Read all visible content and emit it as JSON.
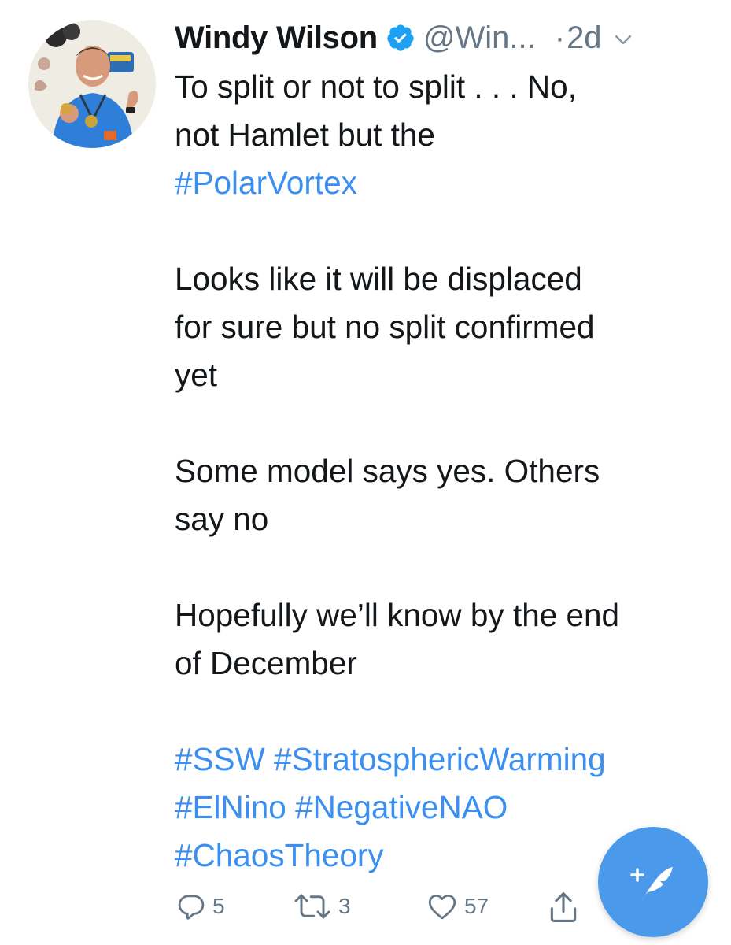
{
  "tweet": {
    "author": {
      "name": "Windy Wilson",
      "handle": "@Win...",
      "verified": true
    },
    "timestamp_separator": "·",
    "timestamp": "2d",
    "paragraphs": [
      {
        "lines": [
          [
            {
              "text": "To split or not to split . . . No,",
              "tag": false
            }
          ],
          [
            {
              "text": "not Hamlet but the",
              "tag": false
            }
          ],
          [
            {
              "text": "#PolarVortex",
              "tag": true
            }
          ]
        ]
      },
      {
        "lines": [
          [
            {
              "text": "Looks like it will be displaced",
              "tag": false
            }
          ],
          [
            {
              "text": "for sure but no split confirmed",
              "tag": false
            }
          ],
          [
            {
              "text": "yet",
              "tag": false
            }
          ]
        ]
      },
      {
        "lines": [
          [
            {
              "text": "Some model says yes. Others",
              "tag": false
            }
          ],
          [
            {
              "text": "say no",
              "tag": false
            }
          ]
        ]
      },
      {
        "lines": [
          [
            {
              "text": "Hopefully we’ll know by the end",
              "tag": false
            }
          ],
          [
            {
              "text": "of December",
              "tag": false
            }
          ]
        ]
      },
      {
        "lines": [
          [
            {
              "text": "#SSW",
              "tag": true
            },
            {
              "text": " ",
              "tag": false
            },
            {
              "text": "#StratosphericWarming",
              "tag": true
            }
          ],
          [
            {
              "text": "#ElNino",
              "tag": true
            },
            {
              "text": " ",
              "tag": false
            },
            {
              "text": "#NegativeNAO",
              "tag": true
            }
          ],
          [
            {
              "text": "#ChaosTheory",
              "tag": true
            }
          ]
        ]
      }
    ],
    "actions": {
      "reply": {
        "icon": "reply-icon",
        "count": "5"
      },
      "retweet": {
        "icon": "retweet-icon",
        "count": "3"
      },
      "like": {
        "icon": "heart-icon",
        "count": "57"
      },
      "share": {
        "icon": "share-icon",
        "count": ""
      }
    }
  },
  "compose_button": {
    "icon": "compose-feather-icon"
  },
  "colors": {
    "text": "#14171a",
    "secondary": "#657786",
    "hashtag": "#3a8ff0",
    "verified": "#1da1f2",
    "fab": "#4a99ea"
  }
}
